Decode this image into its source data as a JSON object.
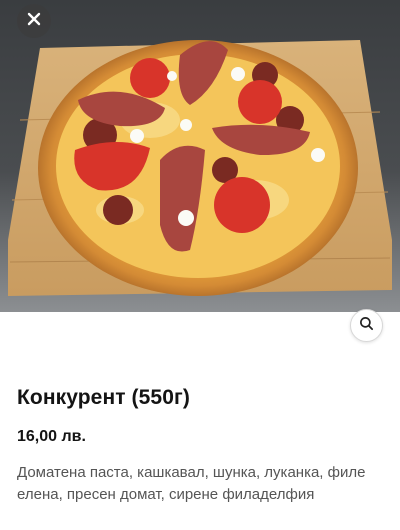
{
  "product": {
    "title": "Конкурент (550г)",
    "price": "16,00 лв.",
    "description": "Доматена паста, кашкавал, шунка, луканка, филе елена, пресен домат, сирене филаделфия"
  },
  "controls": {
    "close_icon": "close-icon",
    "zoom_icon": "search-icon"
  },
  "colors": {
    "title": "#141414",
    "description": "#555555",
    "close_button_bg": "#3c3c3c"
  }
}
